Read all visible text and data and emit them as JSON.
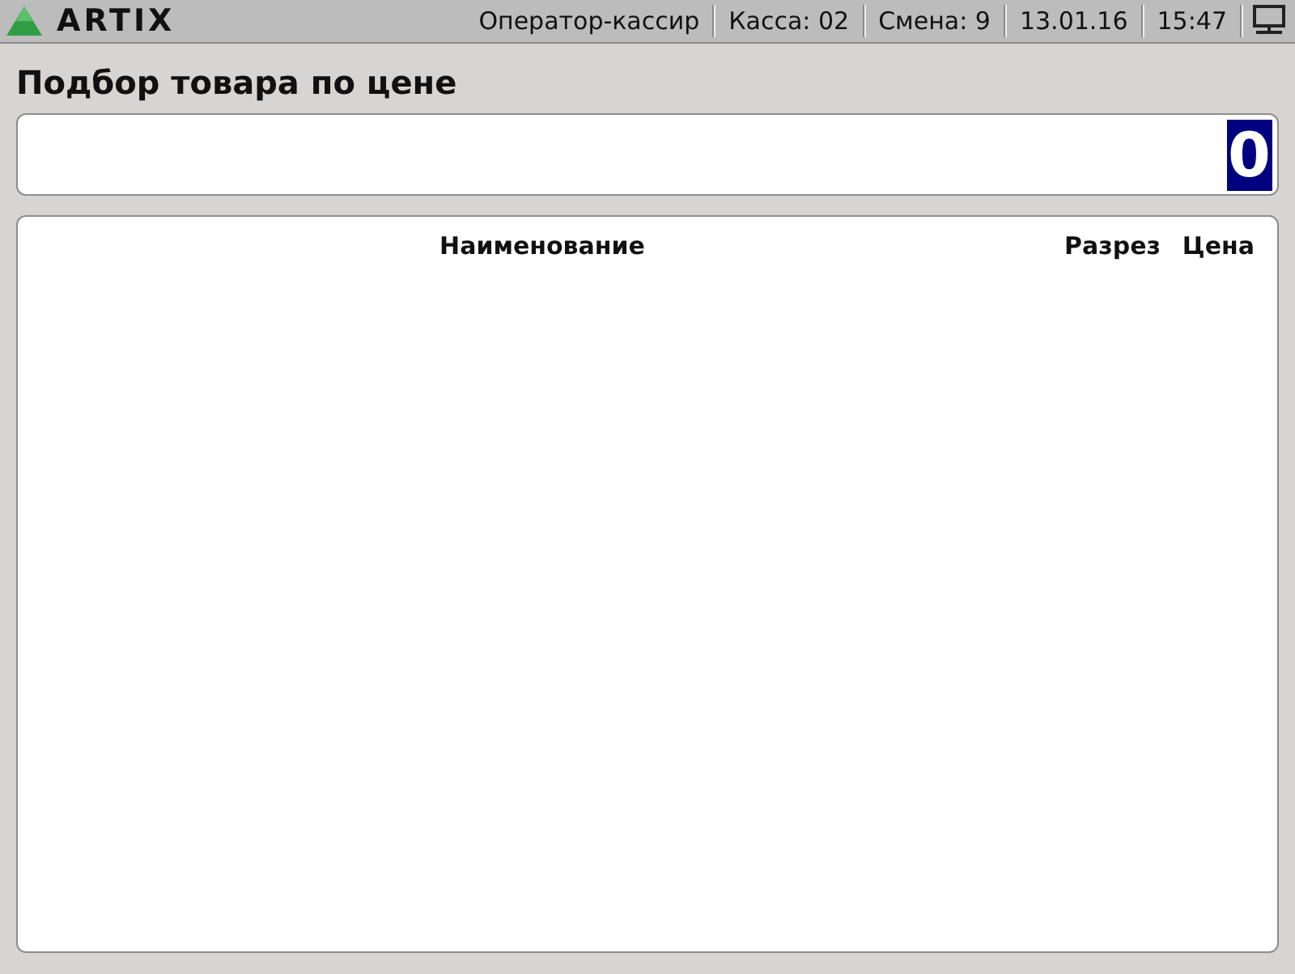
{
  "top_bar": {
    "logo_text": "ARTIX",
    "items": [
      "Оператор-кассир",
      "Касса: 02",
      "Смена: 9",
      "13.01.16",
      "15:47"
    ]
  },
  "title": "Подбор товара по цене",
  "price_field": {
    "value": "0",
    "selected": true
  },
  "table": {
    "columns": [
      "Наименование",
      "Разрез",
      "Цена"
    ]
  }
}
